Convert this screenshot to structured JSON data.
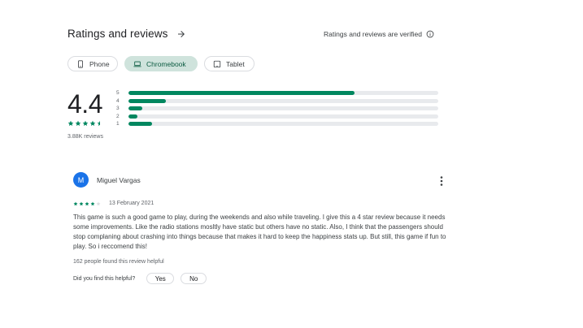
{
  "section": {
    "title": "Ratings and reviews",
    "verified_text": "Ratings and reviews are verified"
  },
  "devices": [
    {
      "label": "Phone",
      "selected": false,
      "icon": "phone-icon"
    },
    {
      "label": "Chromebook",
      "selected": true,
      "icon": "laptop-icon"
    },
    {
      "label": "Tablet",
      "selected": false,
      "icon": "tablet-icon"
    }
  ],
  "summary": {
    "score": "4.4",
    "stars": 4.5,
    "review_count": "3.88K reviews"
  },
  "distribution": [
    {
      "label": "5",
      "fraction": 0.73
    },
    {
      "label": "4",
      "fraction": 0.12
    },
    {
      "label": "3",
      "fraction": 0.045
    },
    {
      "label": "2",
      "fraction": 0.03
    },
    {
      "label": "1",
      "fraction": 0.075
    }
  ],
  "review": {
    "avatar_letter": "M",
    "author": "Miguel Vargas",
    "stars": 4,
    "date": "13 February 2021",
    "text": "This game is such a good game to play, during the weekends and also while traveling. I give this a 4 star review because it needs some improvements. Like the radio stations mosltly have static but others have no static. Also, I think that the passengers should stop complaning about crashing into things because that makes it hard to keep the happiness stats up. But still, this game if fun to play. So i reccomend this!",
    "helpful_count": "162 people found this review helpful",
    "helpful_question": "Did you find this helpful?",
    "yes_label": "Yes",
    "no_label": "No"
  },
  "colors": {
    "accent": "#01875f",
    "chip_selected_bg": "#cfe3dc",
    "avatar_bg": "#1a73e8",
    "track": "#e8eaed"
  }
}
